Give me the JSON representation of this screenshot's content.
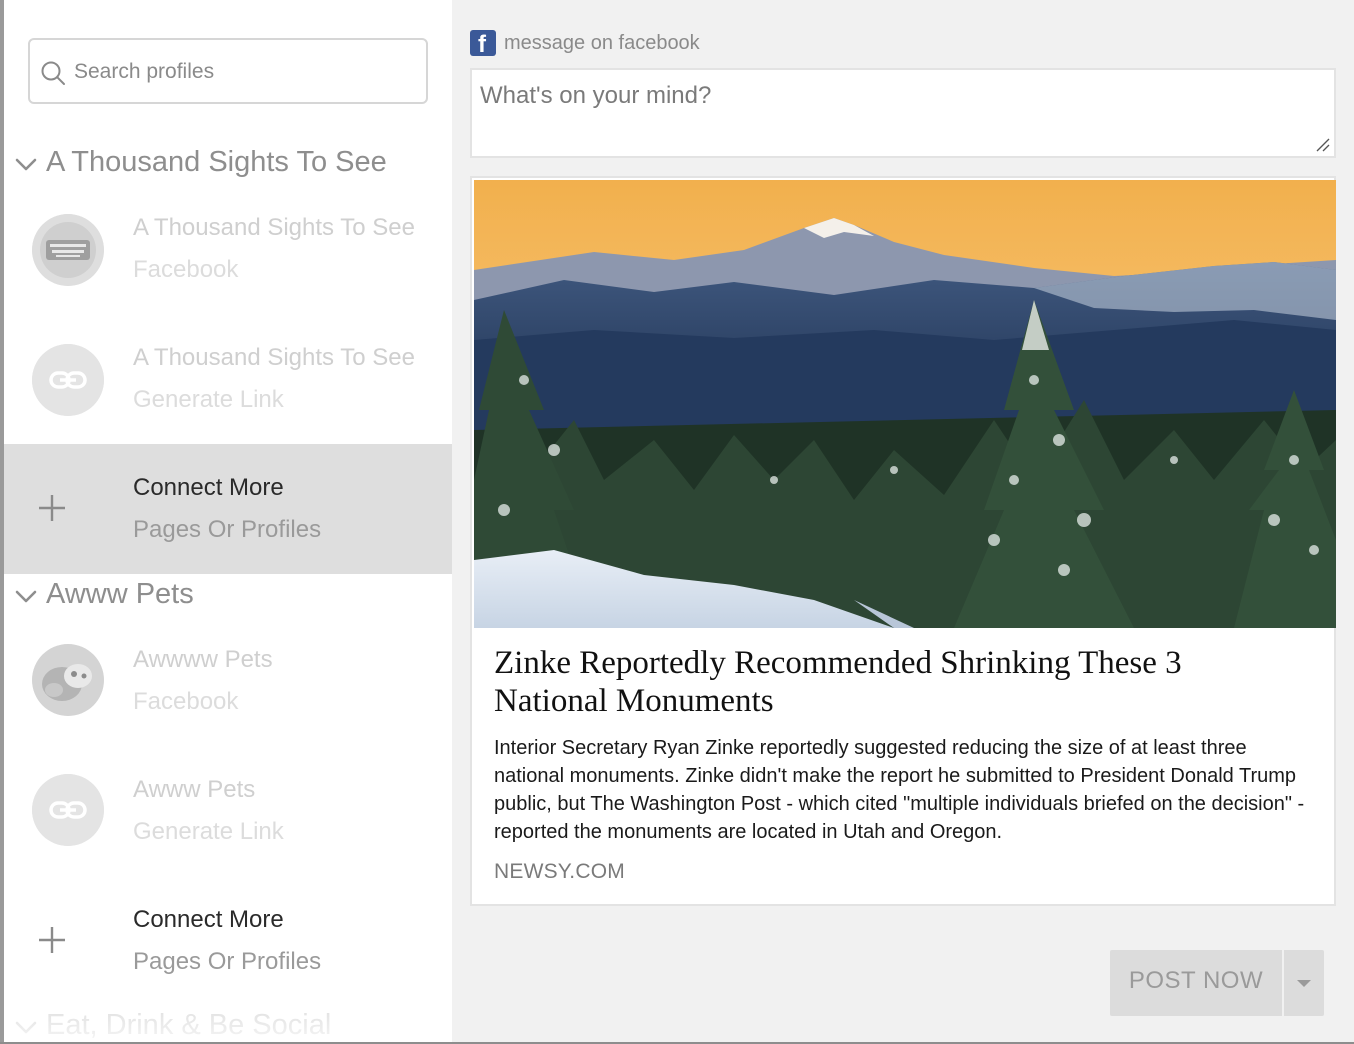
{
  "search": {
    "placeholder": "Search profiles"
  },
  "groups": [
    {
      "title": "A Thousand Sights To See",
      "rows": [
        {
          "line1": "A Thousand Sights To See",
          "line2": "Facebook",
          "avatar": "logo-avatar"
        },
        {
          "line1": "A Thousand Sights To See",
          "line2": "Generate Link",
          "avatar": "link-icon"
        },
        {
          "line1": "Connect More",
          "line2": "Pages Or Profiles",
          "avatar": "plus-icon"
        }
      ]
    },
    {
      "title": "Awww Pets",
      "rows": [
        {
          "line1": "Awwww Pets",
          "line2": "Facebook",
          "avatar": "pet-avatar"
        },
        {
          "line1": "Awww Pets",
          "line2": "Generate Link",
          "avatar": "link-icon"
        },
        {
          "line1": "Connect More",
          "line2": "Pages Or Profiles",
          "avatar": "plus-icon"
        }
      ]
    },
    {
      "title": "Eat, Drink & Be Social"
    }
  ],
  "composer": {
    "channel_icon": "facebook-icon",
    "channel_label": "message on facebook",
    "placeholder": "What's on your mind?"
  },
  "preview": {
    "image": "snowy-forest-mountain-photo",
    "title": "Zinke Reportedly Recommended Shrinking These 3 National Monuments",
    "description": "Interior Secretary Ryan Zinke reportedly suggested reducing the size of at least three national monuments. Zinke didn't make the report he submitted to President Donald Trump public, but The Washington Post - which cited \"multiple individuals briefed on the decision\" - reported the monuments are located in Utah and Oregon.",
    "domain": "NEWSY.COM"
  },
  "actions": {
    "post_label": "POST NOW"
  },
  "colors": {
    "facebook": "#3b5998",
    "active_row": "#dedede",
    "panel_bg": "#f1f1f1"
  }
}
